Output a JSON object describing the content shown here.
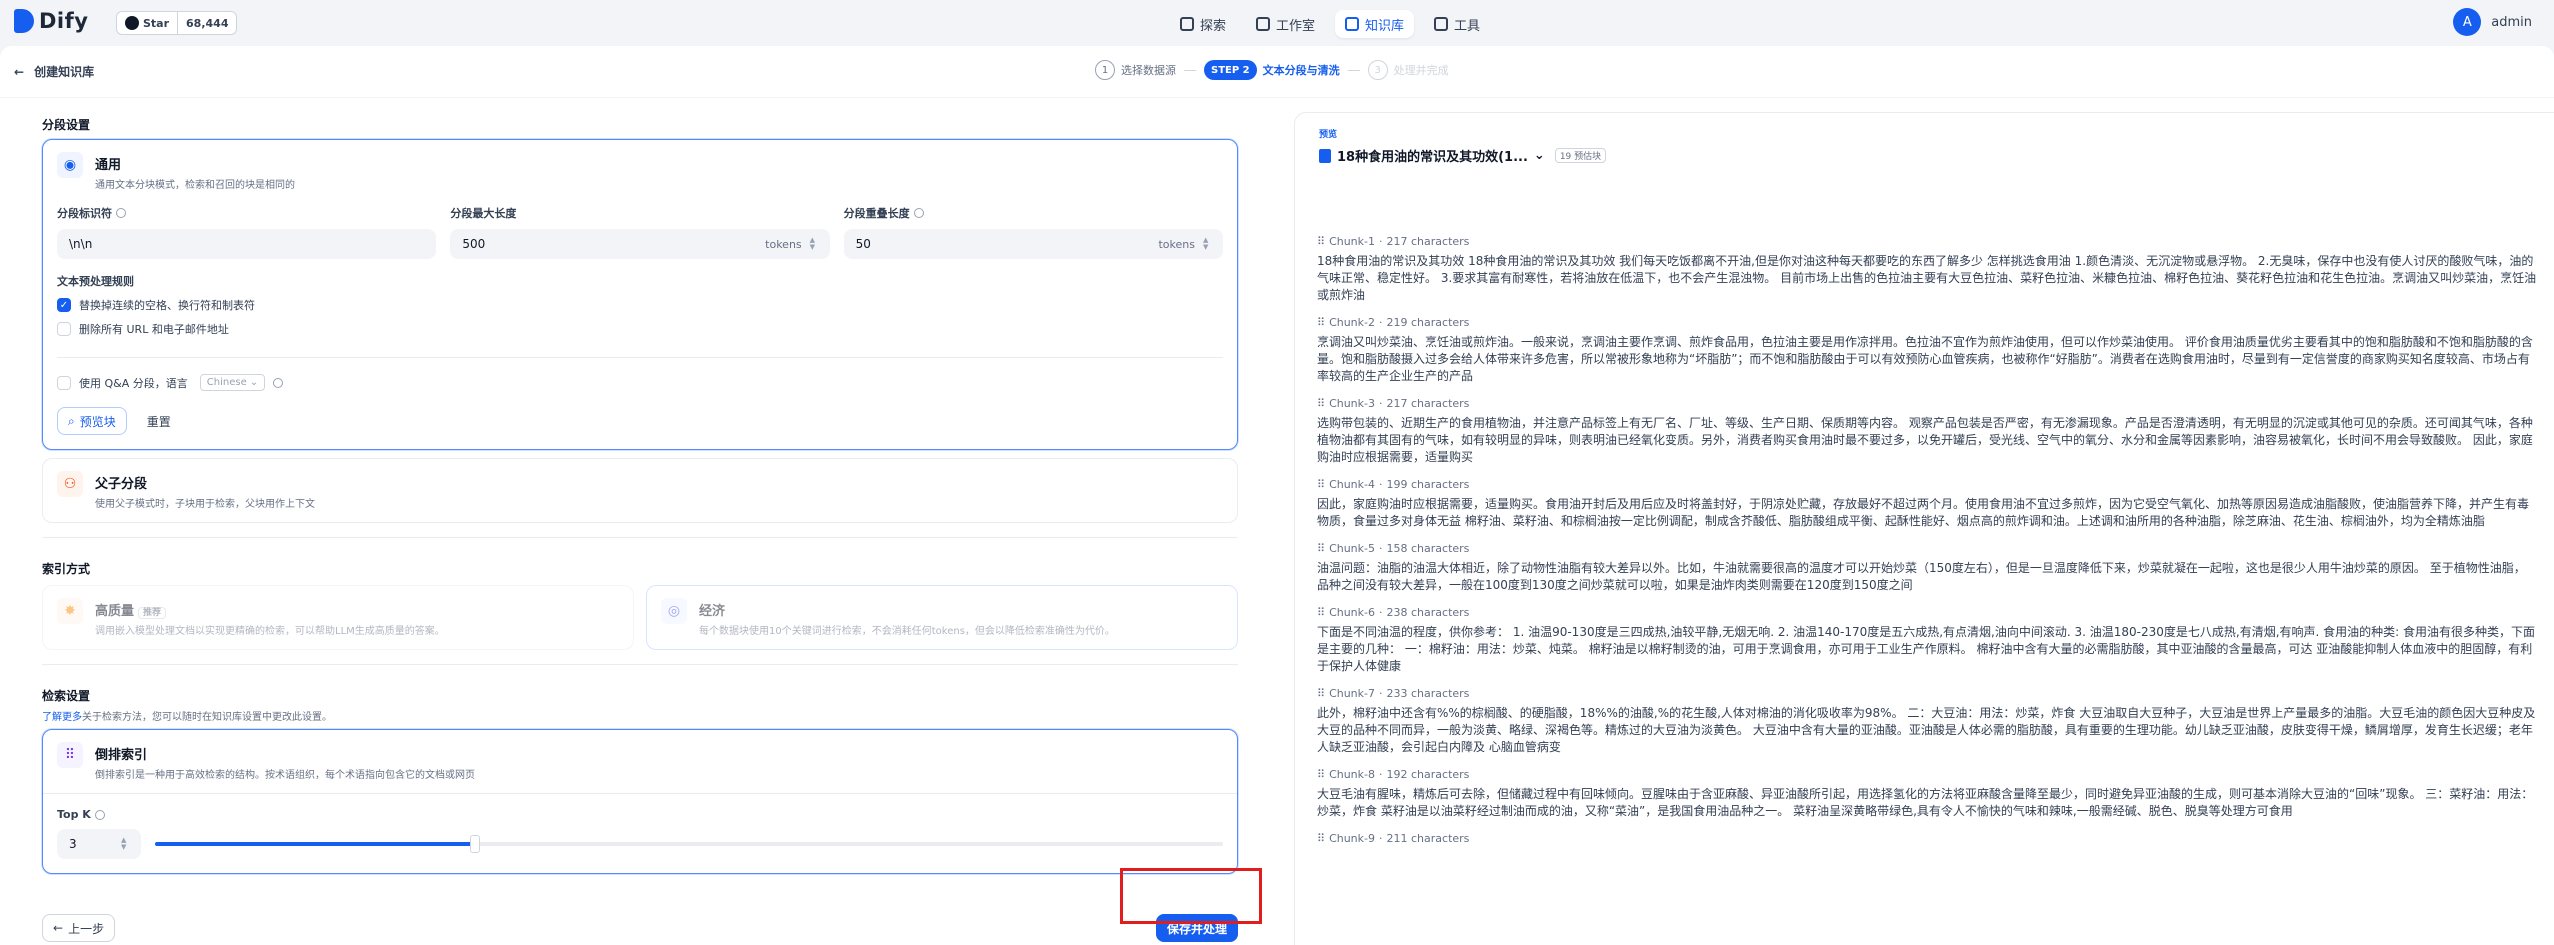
{
  "app": {
    "name": "Dify",
    "star_label": "Star",
    "star_count": "68,444"
  },
  "nav": [
    {
      "label": "探索",
      "icon": "compass-icon"
    },
    {
      "label": "工作室",
      "icon": "robot-icon"
    },
    {
      "label": "知识库",
      "icon": "book-icon",
      "active": true
    },
    {
      "label": "工具",
      "icon": "hammer-icon"
    }
  ],
  "user": {
    "initial": "A",
    "name": "admin"
  },
  "page": {
    "back_label": "创建知识库"
  },
  "steps": [
    {
      "num": "1",
      "label": "选择数据源"
    },
    {
      "num": "STEP 2",
      "label": "文本分段与清洗"
    },
    {
      "num": "3",
      "label": "处理并完成"
    }
  ],
  "segment": {
    "title": "分段设置",
    "general": {
      "title": "通用",
      "desc": "通用文本分块模式，检索和召回的块是相同的",
      "f1_label": "分段标识符",
      "f1_value": "\\n\\n",
      "f2_label": "分段最大长度",
      "f2_value": "500",
      "f2_unit": "tokens",
      "f3_label": "分段重叠长度",
      "f3_value": "50",
      "f3_unit": "tokens",
      "rules_title": "文本预处理规则",
      "rule1": "替换掉连续的空格、换行符和制表符",
      "rule2": "删除所有 URL 和电子邮件地址",
      "qa_label": "使用 Q&A 分段，语言",
      "qa_lang": "Chinese",
      "preview_btn": "预览块",
      "reset_btn": "重置"
    },
    "parent": {
      "title": "父子分段",
      "desc": "使用父子模式时，子块用于检索，父块用作上下文"
    }
  },
  "index": {
    "title": "索引方式",
    "high": {
      "title": "高质量",
      "tag": "推荐",
      "desc": "调用嵌入模型处理文档以实现更精确的检索，可以帮助LLM生成高质量的答案。"
    },
    "eco": {
      "title": "经济",
      "desc": "每个数据块使用10个关键词进行检索，不会消耗任何tokens，但会以降低检索准确性为代价。"
    }
  },
  "retrieval": {
    "title": "检索设置",
    "link": "了解更多",
    "desc": "关于检索方法，您可以随时在知识库设置中更改此设置。",
    "inverted": {
      "title": "倒排索引",
      "desc": "倒排索引是一种用于高效检索的结构。按术语组织，每个术语指向包含它的文档或网页"
    },
    "topk_label": "Top K",
    "topk_value": "3",
    "topk_fraction": 0.3
  },
  "actions": {
    "prev": "上一步",
    "save": "保存并处理"
  },
  "preview": {
    "label": "预览",
    "doc_title": "18种食用油的常识及其功效(1...",
    "badge": "19 预估块",
    "chunks": [
      {
        "id": "Chunk-1",
        "chars": "217 characters",
        "text": "18种食用油的常识及其功效 18种食用油的常识及其功效 我们每天吃饭都离不开油,但是你对油这种每天都要吃的东西了解多少 怎样挑选食用油 1.颜色清淡、无沉淀物或悬浮物。 2.无臭味，保存中也没有使人讨厌的酸败气味，油的气味正常、稳定性好。 3.要求其富有耐寒性，若将油放在低温下，也不会产生混浊物。 目前市场上出售的色拉油主要有大豆色拉油、菜籽色拉油、米糠色拉油、棉籽色拉油、葵花籽色拉油和花生色拉油。烹调油又叫炒菜油，烹饪油或煎炸油"
      },
      {
        "id": "Chunk-2",
        "chars": "219 characters",
        "text": "烹调油又叫炒菜油、烹饪油或煎炸油。一般来说，烹调油主要作烹调、煎炸食品用，色拉油主要是用作凉拌用。色拉油不宜作为煎炸油使用，但可以作炒菜油使用。 评价食用油质量优劣主要看其中的饱和脂肪酸和不饱和脂肪酸的含量。饱和脂肪酸摄入过多会给人体带来许多危害，所以常被形象地称为“坏脂肪”；而不饱和脂肪酸由于可以有效预防心血管疾病，也被称作“好脂肪”。消费者在选购食用油时，尽量到有一定信誉度的商家购买知名度较高、市场占有率较高的生产企业生产的产品"
      },
      {
        "id": "Chunk-3",
        "chars": "217 characters",
        "text": "选购带包装的、近期生产的食用植物油，并注意产品标签上有无厂名、厂址、等级、生产日期、保质期等内容。 观察产品包装是否严密，有无渗漏现象。产品是否澄清透明，有无明显的沉淀或其他可见的杂质。还可闻其气味，各种植物油都有其固有的气味，如有较明显的异味，则表明油已经氧化变质。另外，消费者购买食用油时最不要过多，以免开罐后，受光线、空气中的氧分、水分和金属等因素影响，油容易被氧化，长时间不用会导致酸败。 因此，家庭购油时应根据需要，适量购买"
      },
      {
        "id": "Chunk-4",
        "chars": "199 characters",
        "text": "因此，家庭购油时应根据需要，适量购买。食用油开封后及用后应及时将盖封好，于阴凉处贮藏，存放最好不超过两个月。使用食用油不宜过多煎炸，因为它受空气氧化、加热等原因易造成油脂酸败，使油脂营养下降，并产生有毒物质，食量过多对身体无益 棉籽油、菜籽油、和棕榈油按一定比例调配，制成含芥酸低、脂肪酸组成平衡、起酥性能好、烟点高的煎炸调和油。上述调和油所用的各种油脂，除芝麻油、花生油、棕榈油外，均为全精炼油脂"
      },
      {
        "id": "Chunk-5",
        "chars": "158 characters",
        "text": "油温问题：油脂的油温大体相近，除了动物性油脂有较大差异以外。比如，牛油就需要很高的温度才可以开始炒菜（150度左右），但是一旦温度降低下来，炒菜就凝在一起啦，这也是很少人用牛油炒菜的原因。 至于植物性油脂，品种之间没有较大差异，一般在100度到130度之间炒菜就可以啦，如果是油炸肉类则需要在120度到150度之间"
      },
      {
        "id": "Chunk-6",
        "chars": "238 characters",
        "text": "下面是不同油温的程度，供你参考： 1. 油温90-130度是三四成热,油较平静,无烟无响. 2. 油温140-170度是五六成热,有点清烟,油向中间滚动. 3. 油温180-230度是七八成热,有清烟,有响声. 食用油的种类: 食用油有很多种类，下面是主要的几种： 一：棉籽油：用法：炒菜、炖菜。 棉籽油是以棉籽制烫的油，可用于烹调食用，亦可用于工业生产作原料。 棉籽油中含有大量的必需脂肪酸，其中亚油酸的含量最高，可达 亚油酸能抑制人体血液中的胆固醇，有利于保护人体健康"
      },
      {
        "id": "Chunk-7",
        "chars": "233 characters",
        "text": "此外，棉籽油中还含有%%的棕榈酸、的硬脂酸，18%%的油酸,%的花生酸,人体对棉油的消化吸收率为98%。 二：大豆油：用法：炒菜，炸食 大豆油取自大豆种子，大豆油是世界上产量最多的油脂。大豆毛油的颜色因大豆种皮及大豆的品种不同而异，一般为淡黄、略绿、深褐色等。精炼过的大豆油为淡黄色。 大豆油中含有大量的亚油酸。亚油酸是人体必需的脂肪酸，具有重要的生理功能。幼儿缺乏亚油酸，皮肤变得干燥，鳞屑增厚，发育生长迟缓；老年人缺乏亚油酸，会引起白内障及 心脑血管病变"
      },
      {
        "id": "Chunk-8",
        "chars": "192 characters",
        "text": "大豆毛油有腥味，精炼后可去除，但储藏过程中有回味倾向。豆腥味由于含亚麻酸、异亚油酸所引起，用选择氢化的方法将亚麻酸含量降至最少，同时避免异亚油酸的生成，则可基本消除大豆油的“回味”现象。 三：菜籽油：用法：炒菜，炸食 菜籽油是以油菜籽经过制油而成的油，又称“菜油”，是我国食用油品种之一。 菜籽油呈深黄略带绿色,具有令人不愉快的气味和辣味,一般需经碱、脱色、脱臭等处理方可食用"
      },
      {
        "id": "Chunk-9",
        "chars": "211 characters",
        "text": ""
      }
    ]
  },
  "colors": {
    "accent": "#155eef",
    "highlight": "#e01e1e"
  }
}
